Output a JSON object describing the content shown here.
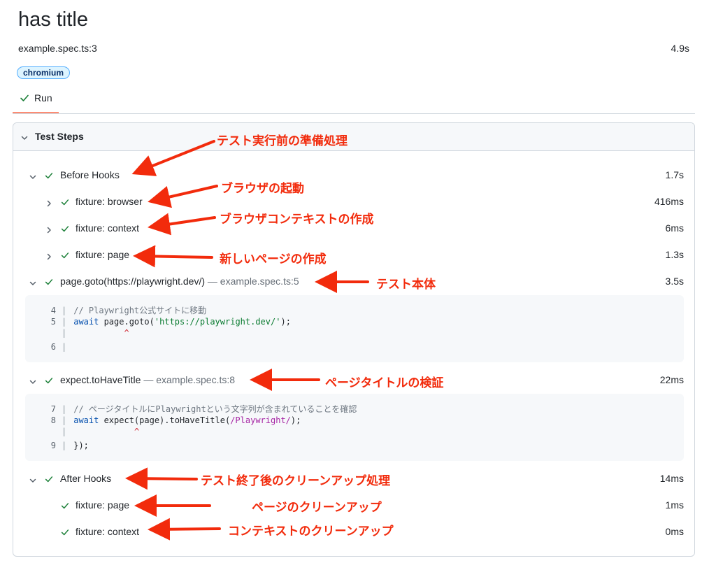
{
  "header": {
    "title": "has title",
    "spec_location": "example.spec.ts:3",
    "duration": "4.9s",
    "project_badge": "chromium"
  },
  "tabs": [
    {
      "label": "Run",
      "status_icon": "check-icon",
      "selected": true
    }
  ],
  "panel": {
    "title": "Test Steps",
    "expanded": true
  },
  "steps": [
    {
      "title": "Before Hooks",
      "location": "",
      "duration": "1.7s"
    },
    {
      "title": "fixture: browser",
      "location": "",
      "duration": "416ms"
    },
    {
      "title": "fixture: context",
      "location": "",
      "duration": "6ms"
    },
    {
      "title": "fixture: page",
      "location": "",
      "duration": "1.3s"
    },
    {
      "title": "page.goto(https://playwright.dev/)",
      "location": "— example.spec.ts:5",
      "duration": "3.5s"
    },
    {
      "title": "expect.toHaveTitle",
      "location": "— example.spec.ts:8",
      "duration": "22ms"
    },
    {
      "title": "After Hooks",
      "location": "",
      "duration": "14ms"
    },
    {
      "title": "fixture: page",
      "location": "",
      "duration": "1ms"
    },
    {
      "title": "fixture: context",
      "location": "",
      "duration": "0ms"
    }
  ],
  "snippets": {
    "goto": {
      "line4_num": "4",
      "line4_text": "// Playwright公式サイトに移動",
      "line5_num": "5",
      "line5_kw": "await",
      "line5_pre": " page.goto(",
      "line5_str": "'https://playwright.dev/'",
      "line5_post": ");",
      "caret": "^",
      "line6_num": "6"
    },
    "expect": {
      "line7_num": "7",
      "line7_text": "// ページタイトルにPlaywrightという文字列が含まれていることを確認",
      "line8_num": "8",
      "line8_kw": "await",
      "line8_pre": " expect(page).toHaveTitle(",
      "line8_re": "/Playwright/",
      "line8_post": ");",
      "caret": "^",
      "line9_num": "9",
      "line9_text": "});"
    }
  },
  "annotations": [
    "テスト実行前の準備処理",
    "ブラウザの起動",
    "ブラウザコンテキストの作成",
    "新しいページの作成",
    "テスト本体",
    "ページタイトルの検証",
    "テスト終了後のクリーンアップ処理",
    "ページのクリーンアップ",
    "コンテキストのクリーンアップ"
  ],
  "colors": {
    "check": "#1a7f37",
    "annotation": "#f22b0c",
    "tab_underline": "#fd8c73",
    "badge_bg": "#ddf4ff",
    "badge_border": "#54aeff",
    "code_bg": "#f6f8fa"
  }
}
